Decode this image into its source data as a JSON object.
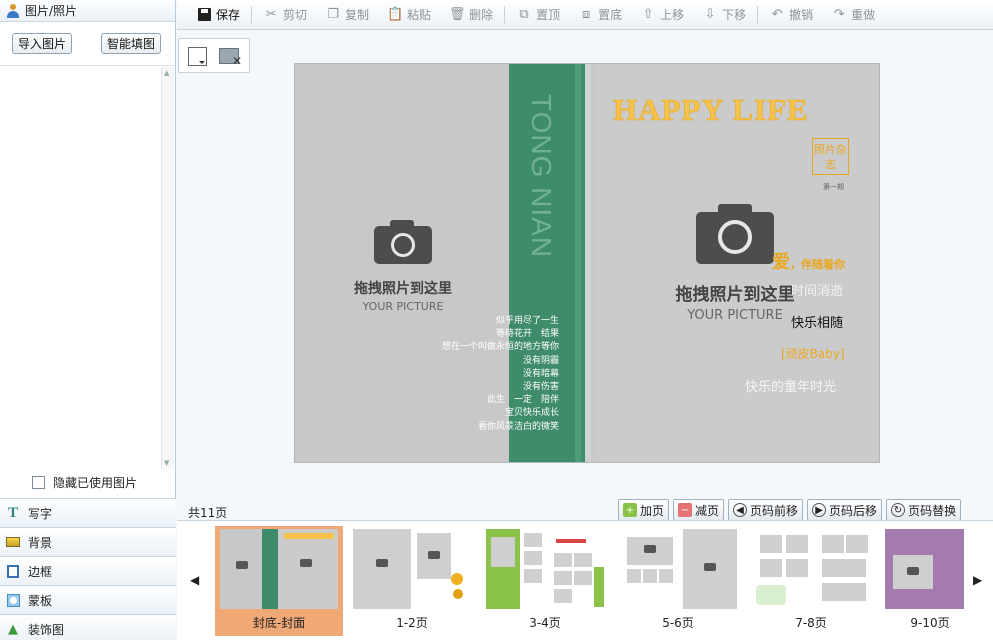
{
  "sidebar": {
    "title": "图片/照片",
    "import_button": "导入图片",
    "smart_fill_button": "智能填图",
    "hide_used_label": "隐藏已使用图片",
    "categories": [
      {
        "label": "写字",
        "icon": "text-t-icon",
        "color": "#2f7f7f"
      },
      {
        "label": "背景",
        "icon": "background-image-icon",
        "color": "#c8a21f"
      },
      {
        "label": "边框",
        "icon": "frame-icon",
        "color": "#3a6fb0"
      },
      {
        "label": "蒙板",
        "icon": "mask-icon",
        "color": "#3a8fd0"
      },
      {
        "label": "装饰图",
        "icon": "decoration-tree-icon",
        "color": "#3c9b3c"
      }
    ]
  },
  "toolbar": {
    "items": [
      {
        "label": "保存",
        "icon": "save-icon",
        "enabled": true
      },
      {
        "label": "剪切",
        "icon": "cut-icon",
        "enabled": false
      },
      {
        "label": "复制",
        "icon": "copy-icon",
        "enabled": false
      },
      {
        "label": "粘贴",
        "icon": "paste-icon",
        "enabled": false
      },
      {
        "label": "删除",
        "icon": "delete-icon",
        "enabled": false
      },
      {
        "label": "置顶",
        "icon": "bring-to-front-icon",
        "enabled": false
      },
      {
        "label": "置底",
        "icon": "send-to-back-icon",
        "enabled": false
      },
      {
        "label": "上移",
        "icon": "move-up-icon",
        "enabled": false
      },
      {
        "label": "下移",
        "icon": "move-down-icon",
        "enabled": false
      },
      {
        "label": "撤销",
        "icon": "undo-icon",
        "enabled": false
      },
      {
        "label": "重做",
        "icon": "redo-icon",
        "enabled": false
      }
    ]
  },
  "canvas": {
    "spine_title": "TONG NIAN",
    "back_placeholder": {
      "title": "拖拽照片到这里",
      "subtitle": "YOUR PICTURE"
    },
    "front_placeholder": {
      "title": "拖拽照片到这里",
      "subtitle": "YOUR PICTURE"
    },
    "poem_lines": [
      "似乎用尽了一生",
      "等待花开　结果",
      "想在一个叫做永恒的地方等你",
      "没有阴霾",
      "没有暗幕",
      "没有伤害",
      "此生　一定　陪伴",
      "宝贝快乐成长",
      "看你风景洁白的微笑"
    ],
    "headline": "HAPPY LIFE",
    "stamp": "照片杂志",
    "issue": "第一期",
    "love_line": {
      "big": "爱",
      "rest": "，伴随着你"
    },
    "line_time": "时间消逝",
    "line_happy": "快乐相随",
    "line_baby": "[顽皮Baby]",
    "line_childhood": "快乐的童年时光",
    "colors": {
      "spine": "#3f8c6a",
      "accent": "#f5c34b",
      "stamp": "#e8a822"
    }
  },
  "pagebar": {
    "count": "共11页",
    "buttons": [
      {
        "label": "加页",
        "icon": "add-page-icon"
      },
      {
        "label": "减页",
        "icon": "remove-page-icon"
      },
      {
        "label": "页码前移",
        "icon": "page-left-icon"
      },
      {
        "label": "页码后移",
        "icon": "page-right-icon"
      },
      {
        "label": "页码替换",
        "icon": "page-swap-icon"
      }
    ]
  },
  "thumbnails": [
    {
      "label": "封底-封面",
      "selected": true
    },
    {
      "label": "1-2页",
      "selected": false
    },
    {
      "label": "3-4页",
      "selected": false
    },
    {
      "label": "5-6页",
      "selected": false
    },
    {
      "label": "7-8页",
      "selected": false
    },
    {
      "label": "9-10页",
      "selected": false
    }
  ]
}
